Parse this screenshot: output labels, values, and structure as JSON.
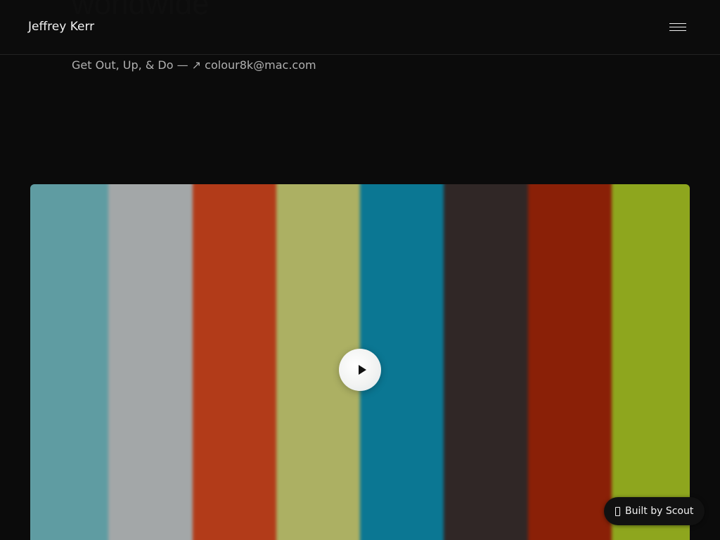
{
  "hero": {
    "heading": "worldwide"
  },
  "header": {
    "site_title": "Jeffrey Kerr",
    "menu_icon": "hamburger-menu-icon"
  },
  "tagline": {
    "text": "Get Out, Up, & Do — ",
    "link_text": "↗ colour8k@mac.com"
  },
  "video": {
    "play_icon": "play-icon",
    "bar_colors": [
      "#5f9ca2",
      "#a3a7a8",
      "#b23b19",
      "#acb063",
      "#0b7793",
      "#302726",
      "#8a2007",
      "#8ea61e"
    ]
  },
  "badge": {
    "icon": "box-icon",
    "label": "Built by Scout"
  }
}
